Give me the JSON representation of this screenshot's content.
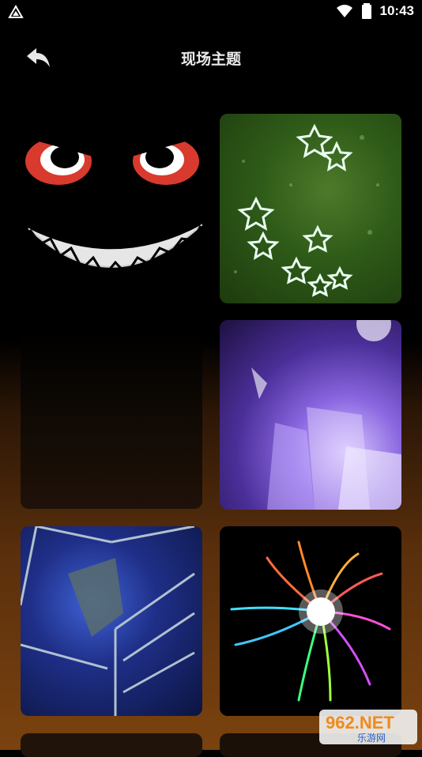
{
  "status_bar": {
    "time": "10:43"
  },
  "header": {
    "title": "现场主题"
  },
  "themes": [
    {
      "icon": "evil-smile-face"
    },
    {
      "icon": "green-snowflake-stars"
    },
    {
      "icon": "purple-light-beams"
    },
    {
      "icon": "blue-crystal-mirror"
    },
    {
      "icon": "rainbow-light-burst"
    }
  ],
  "watermark": {
    "brand": "962.NET",
    "sub": "乐游网"
  }
}
